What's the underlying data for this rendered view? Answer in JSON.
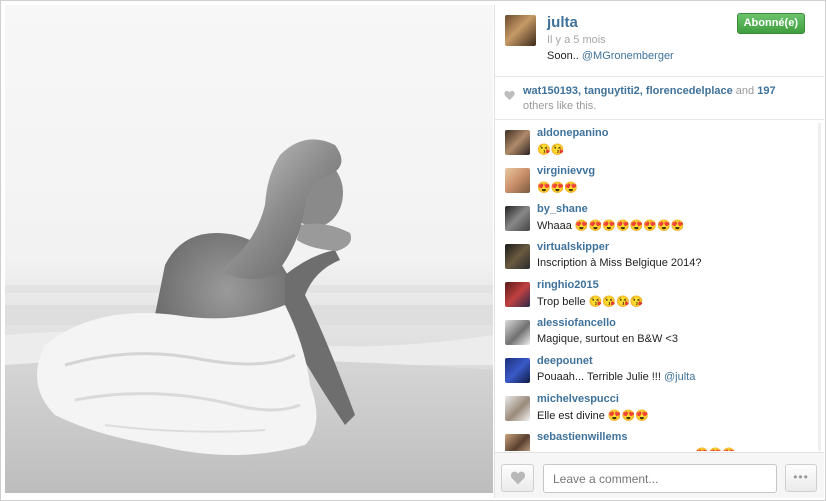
{
  "post": {
    "owner": "julta",
    "time_ago": "Il y a 5 mois",
    "caption_text": "Soon.. ",
    "caption_mention": "@MGronemberger",
    "follow_label": "Abonné(e)"
  },
  "likes": {
    "users": [
      "wat150193",
      "tanguytiti2",
      "florencedelplace"
    ],
    "sep1": ", ",
    "sep2": ", ",
    "and_text": " and ",
    "others_count": "197",
    "others_text": " others like this."
  },
  "comments": [
    {
      "user": "aldonepanino",
      "text": "😘😘"
    },
    {
      "user": "virginievvg",
      "text": "😍😍😍"
    },
    {
      "user": "by_shane",
      "text": "Whaaa 😍😍😍😍😍😍😍😍"
    },
    {
      "user": "virtualskipper",
      "text": "Inscription à Miss Belgique 2014?"
    },
    {
      "user": "ringhio2015",
      "text": "Trop belle 😘😘😘😘"
    },
    {
      "user": "alessiofancello",
      "text": "Magique, surtout en B&W <3"
    },
    {
      "user": "deepounet",
      "text": "Pouaah... Terrible Julie !!! ",
      "mention": "@julta"
    },
    {
      "user": "michelvespucci",
      "text": "Elle est divine 😍😍😍"
    },
    {
      "user": "sebastienwillems",
      "text": "😍😍😍"
    }
  ],
  "footer": {
    "comment_placeholder": "Leave a comment...",
    "more_label": "•••"
  },
  "colors": {
    "link": "#3f729b",
    "follow_green": "#4cae4c"
  }
}
